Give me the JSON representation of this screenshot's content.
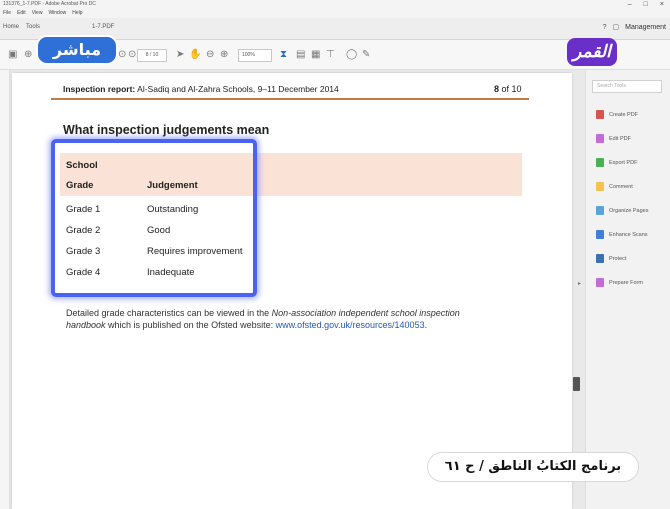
{
  "window": {
    "title": "131376_1-7.PDF - Adobe Acrobat Pro DC",
    "controls": [
      "–",
      "□",
      "×"
    ]
  },
  "menu": [
    "File",
    "Edit",
    "View",
    "Window",
    "Help"
  ],
  "tabs": {
    "home": "Home",
    "tools": "Tools",
    "doc": "1-7.PDF"
  },
  "header_right": {
    "management": "Management"
  },
  "toolbar": {
    "page_field": "8 / 10",
    "zoom": "100%"
  },
  "logos": {
    "live": "مباشر",
    "channel": "القمر"
  },
  "document": {
    "report_label": "Inspection report:",
    "report_title": " Al-Sadiq and Al-Zahra Schools, 9–11 December 2014",
    "page_current": "8",
    "page_of": " of 10",
    "heading": "What inspection judgements mean",
    "table": {
      "school_label": "School",
      "col_grade": "Grade",
      "col_judgement": "Judgement",
      "rows": [
        {
          "grade": "Grade 1",
          "judgement": "Outstanding"
        },
        {
          "grade": "Grade 2",
          "judgement": "Good"
        },
        {
          "grade": "Grade 3",
          "judgement": "Requires improvement"
        },
        {
          "grade": "Grade 4",
          "judgement": "Inadequate"
        }
      ]
    },
    "note_pre": "Detailed grade characteristics can be viewed in the ",
    "note_italic1": "Non-association independent school inspection",
    "note_italic2": "handbook",
    "note_mid": " which is published on the Ofsted website: ",
    "note_link": "www.ofsted.gov.uk/resources/140053",
    "note_end": "."
  },
  "right_panel": {
    "search_placeholder": "Search Tools",
    "tools": [
      {
        "label": "Create PDF",
        "color": "#d9534f"
      },
      {
        "label": "Edit PDF",
        "color": "#c46bd8"
      },
      {
        "label": "Export PDF",
        "color": "#4caf50"
      },
      {
        "label": "Comment",
        "color": "#f2c14e"
      },
      {
        "label": "Organize Pages",
        "color": "#5aa3d8"
      },
      {
        "label": "Enhance Scans",
        "color": "#3f7fd8"
      },
      {
        "label": "Protect",
        "color": "#3b6fb5"
      },
      {
        "label": "Prepare Form",
        "color": "#c46bd8"
      }
    ]
  },
  "caption": "برنامج الكتابُ الناطق / ح ٦١",
  "colors": {
    "highlight": "#4a63f4",
    "table_band": "#fbe2d7",
    "header_rule": "#c97a3e",
    "link": "#2359b8"
  }
}
